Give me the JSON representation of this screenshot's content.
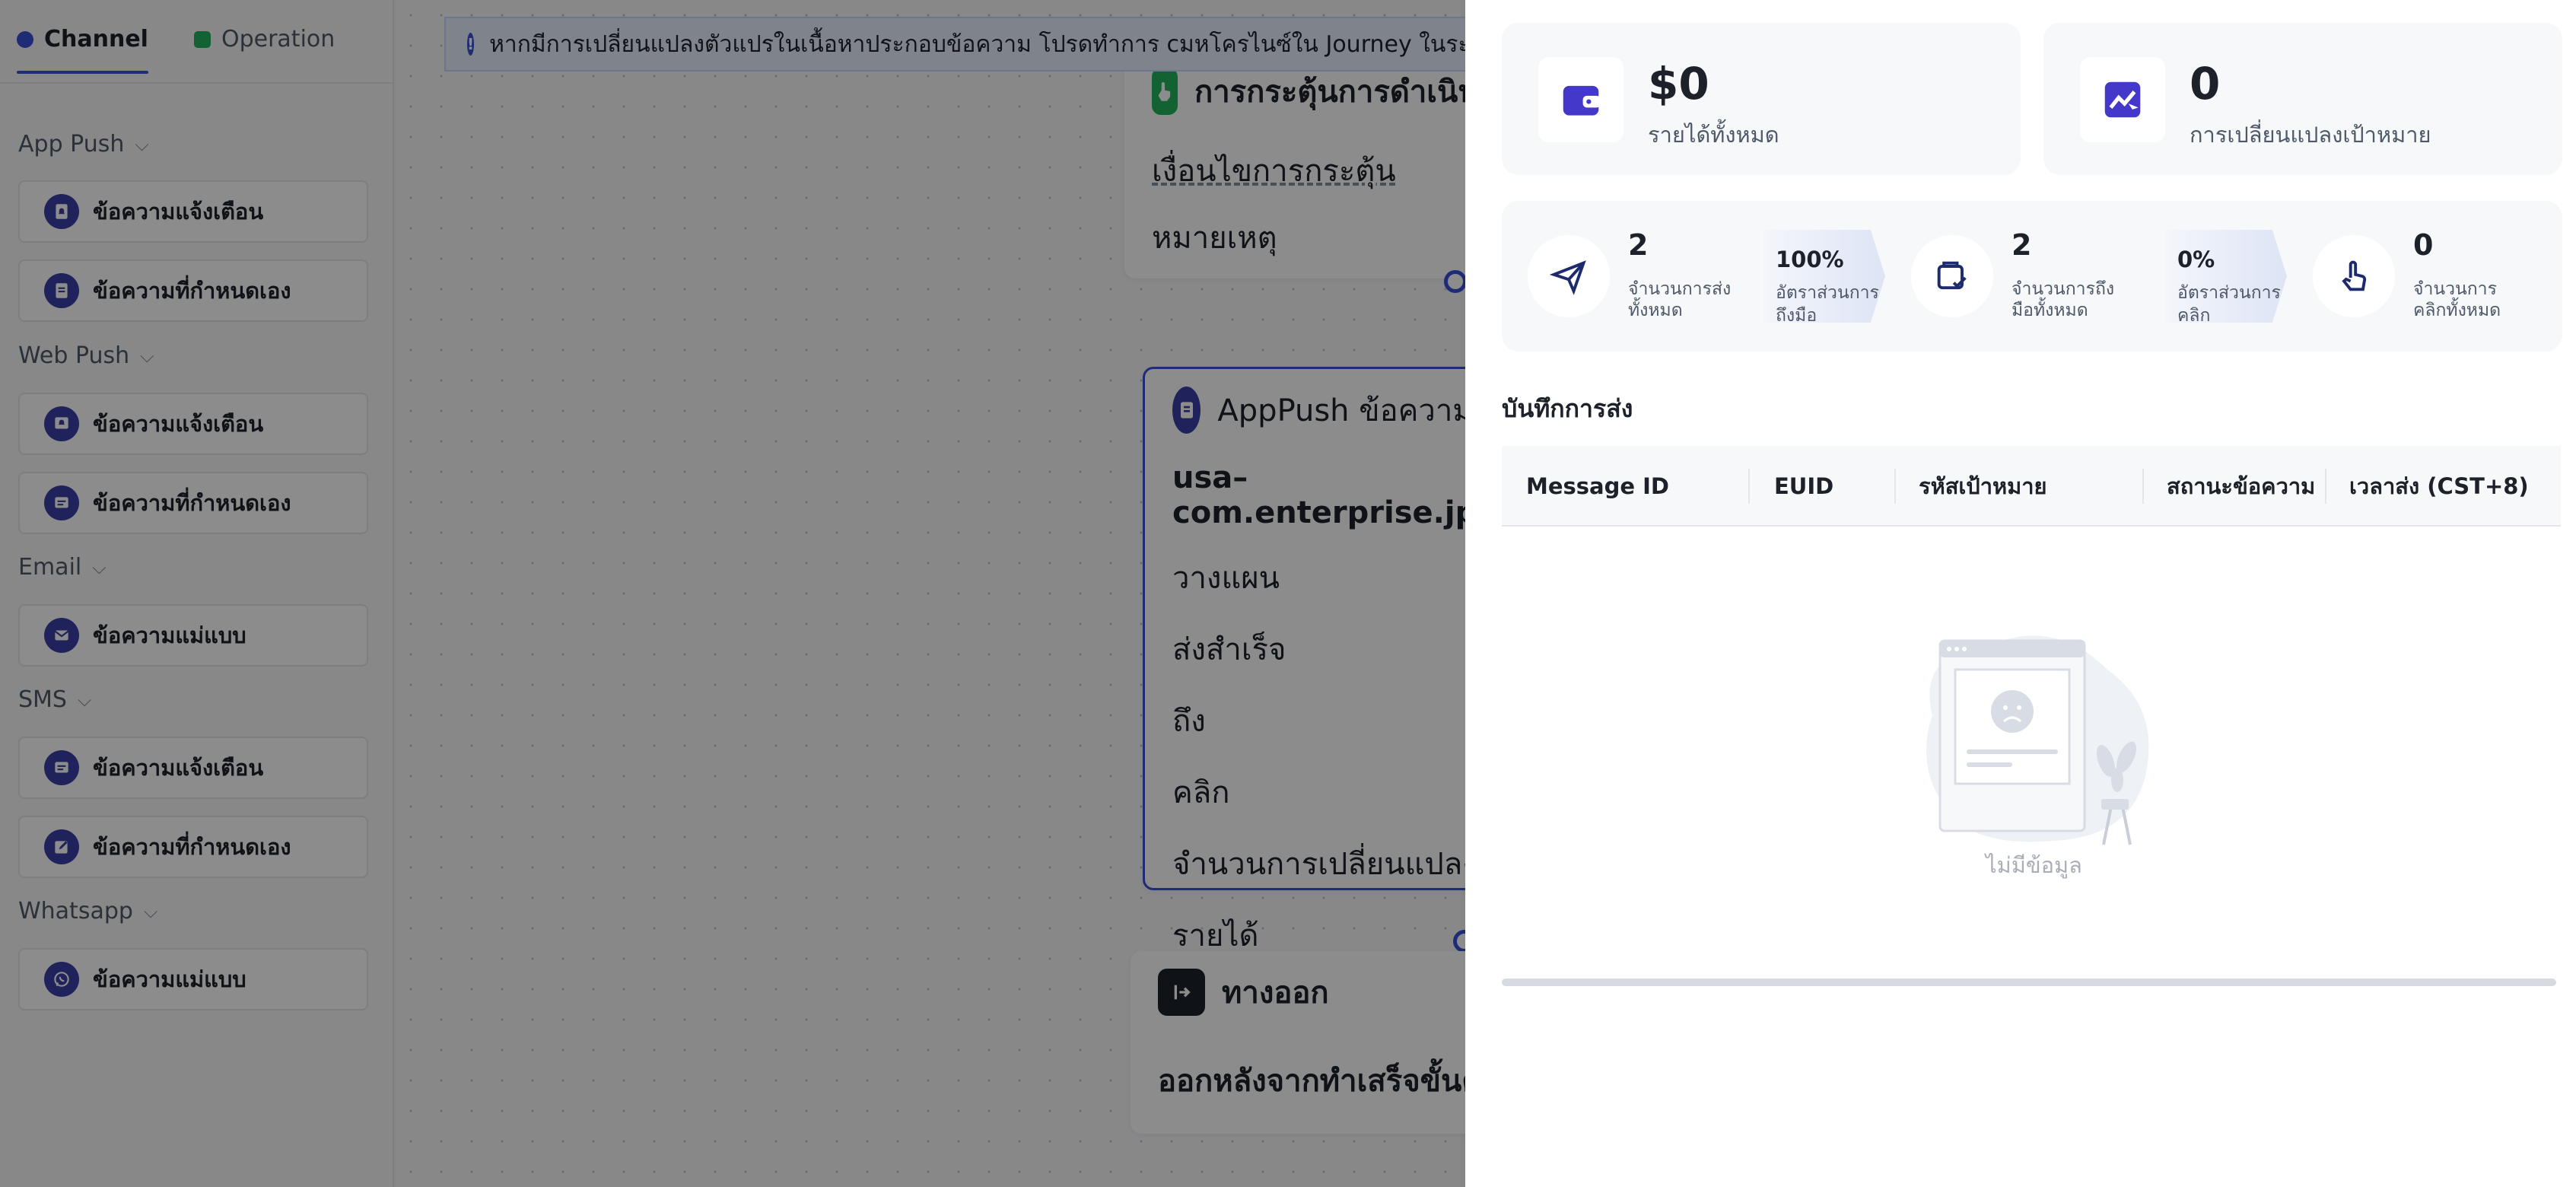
{
  "tabs": [
    {
      "label": "Channel",
      "dot_color": "#3b4fd8",
      "active": true
    },
    {
      "label": "Operation",
      "dot_color": "#22b35e",
      "active": false
    }
  ],
  "sidebar": {
    "groups": [
      {
        "title": "App Push",
        "items": [
          {
            "label": "ข้อความแจ้งเตือน",
            "icon": "bell-icon"
          },
          {
            "label": "ข้อความที่กำหนดเอง",
            "icon": "document-icon"
          }
        ]
      },
      {
        "title": "Web Push",
        "items": [
          {
            "label": "ข้อความแจ้งเตือน",
            "icon": "bell-icon"
          },
          {
            "label": "ข้อความที่กำหนดเอง",
            "icon": "message-icon"
          }
        ]
      },
      {
        "title": "Email",
        "items": [
          {
            "label": "ข้อความแม่แบบ",
            "icon": "mail-icon"
          }
        ]
      },
      {
        "title": "SMS",
        "items": [
          {
            "label": "ข้อความแจ้งเตือน",
            "icon": "message-icon"
          },
          {
            "label": "ข้อความที่กำหนดเอง",
            "icon": "edit-icon"
          }
        ]
      },
      {
        "title": "Whatsapp",
        "items": [
          {
            "label": "ข้อความแม่แบบ",
            "icon": "whatsapp-icon"
          }
        ]
      }
    ]
  },
  "banner": {
    "text": "หากมีการเปลี่ยนแปลงตัวแปรในเนื้อหาประกอบข้อความ โปรดทำการ cมหโครไนซ์ใน Journey ในระยะเวลาที่ดีแ"
  },
  "canvas": {
    "trigger_node": {
      "title": "การกระตุ้นการดำเนินก",
      "rows": [
        "เงื่อนไขการกระตุ้น",
        "หมายเหตุ"
      ]
    },
    "apppush_node": {
      "title": "AppPush ข้อความข",
      "subtitle": "usa–com.enterprise.jp",
      "rows": [
        "วางแผน",
        "ส่งสำเร็จ",
        "ถึง",
        "คลิก",
        "จำนวนการเปลี่ยนแปลง",
        "รายได้"
      ]
    },
    "exit_node": {
      "title": "ทางออก",
      "row": "ออกหลังจากทำเสร็จขั้นตอน"
    }
  },
  "panel": {
    "revenue": {
      "value": "$0",
      "label": "รายได้ทั้งหมด"
    },
    "conversion": {
      "value": "0",
      "label": "การเปลี่ยนแปลงเป้าหมาย"
    },
    "stats": {
      "sent": {
        "value": "2",
        "label": "จำนวนการส่งทั้งหมด"
      },
      "reach_rate": {
        "value": "100%",
        "label": "อัตราส่วนการถึงมือ"
      },
      "reached": {
        "value": "2",
        "label": "จำนวนการถึงมือทั้งหมด"
      },
      "click_rate": {
        "value": "0%",
        "label": "อัตราส่วนการคลิก"
      },
      "clicks": {
        "value": "0",
        "label": "จำนวนการคลิกทั้งหมด"
      }
    },
    "log_title": "บันทึกการส่ง",
    "columns": [
      "Message ID",
      "EUID",
      "รหัสเป้าหมาย",
      "สถานะข้อความ",
      "เวลาส่ง (CST+8)"
    ],
    "empty_text": "ไม่มีข้อมูล"
  },
  "colors": {
    "accent": "#3b4fd8",
    "icon_dark": "#3b3fa8",
    "brand_green": "#22b35e"
  }
}
